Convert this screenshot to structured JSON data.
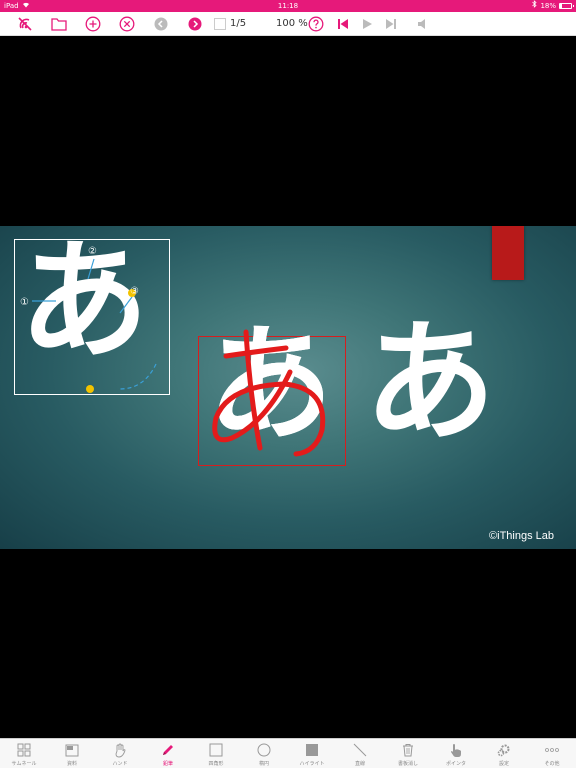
{
  "status_bar": {
    "device": "iPad",
    "time": "11:18",
    "battery": "18%",
    "battery_level": 0.18
  },
  "toolbar": {
    "page_current": "",
    "page_count": "1/5",
    "zoom": "100 %"
  },
  "slide": {
    "left_char": "あ",
    "middle_char": "あ",
    "right_char": "あ",
    "stroke_numbers": [
      "①",
      "②",
      "③"
    ],
    "copyright": "©iThings Lab"
  },
  "tabs": [
    {
      "label": "サムネール",
      "icon": "grid-icon"
    },
    {
      "label": "資料",
      "icon": "document-icon"
    },
    {
      "label": "ハンド",
      "icon": "hand-icon"
    },
    {
      "label": "鉛筆",
      "icon": "pencil-icon",
      "active": true
    },
    {
      "label": "四角形",
      "icon": "square-icon"
    },
    {
      "label": "楕円",
      "icon": "circle-icon"
    },
    {
      "label": "ハイライト",
      "icon": "highlight-icon"
    },
    {
      "label": "直線",
      "icon": "line-icon"
    },
    {
      "label": "書板消し",
      "icon": "trash-icon"
    },
    {
      "label": "ポインタ",
      "icon": "pointer-icon"
    },
    {
      "label": "設定",
      "icon": "gear-icon"
    },
    {
      "label": "その他",
      "icon": "more-icon"
    }
  ],
  "colors": {
    "accent": "#e6197a",
    "ribbon": "#b81a1a",
    "ink": "#e31b1b"
  }
}
